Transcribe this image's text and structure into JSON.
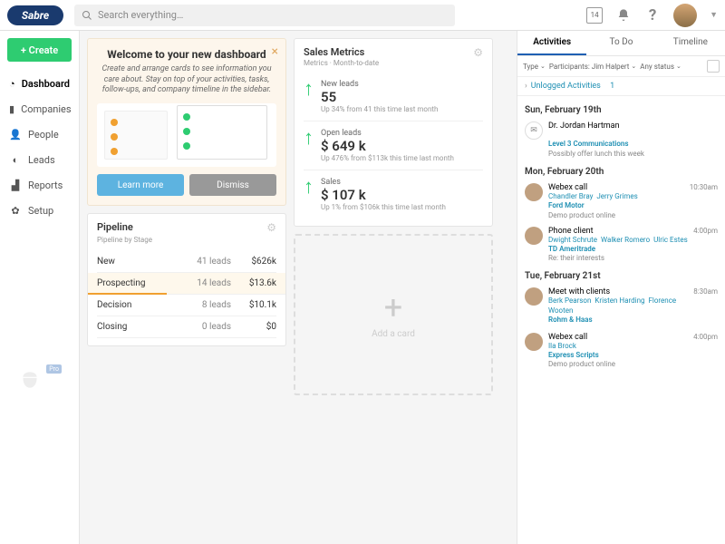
{
  "header": {
    "logo": "Sabre",
    "search_placeholder": "Search everything…",
    "cal_badge": "14"
  },
  "sidebar": {
    "create": "+ Create",
    "items": [
      {
        "label": "Dashboard",
        "active": true
      },
      {
        "label": "Companies"
      },
      {
        "label": "People"
      },
      {
        "label": "Leads"
      },
      {
        "label": "Reports"
      },
      {
        "label": "Setup"
      }
    ],
    "pro": "Pro"
  },
  "welcome": {
    "title": "Welcome to your new dashboard",
    "body": "Create and arrange cards to see information you care about. Stay on top of your activities, tasks, follow-ups, and company timeline in the sidebar.",
    "learn": "Learn more",
    "dismiss": "Dismiss"
  },
  "pipeline": {
    "title": "Pipeline",
    "sub": "Pipeline by Stage",
    "rows": [
      {
        "name": "New",
        "leads": "41 leads",
        "val": "$626k"
      },
      {
        "name": "Prospecting",
        "leads": "14 leads",
        "val": "$13.6k",
        "hl": true
      },
      {
        "name": "Decision",
        "leads": "8 leads",
        "val": "$10.1k"
      },
      {
        "name": "Closing",
        "leads": "0 leads",
        "val": "$0"
      }
    ]
  },
  "metrics": {
    "title": "Sales Metrics",
    "sub": "Metrics · Month-to-date",
    "rows": [
      {
        "label": "New leads",
        "val": "55",
        "chg": "Up 34% from 41 this time last month"
      },
      {
        "label": "Open leads",
        "val": "$ 649 k",
        "chg": "Up 476% from $113k this time last month"
      },
      {
        "label": "Sales",
        "val": "$ 107 k",
        "chg": "Up 1% from $106k this time last month"
      }
    ]
  },
  "addcard": "Add a card",
  "right": {
    "tabs": [
      "Activities",
      "To Do",
      "Timeline"
    ],
    "filters": {
      "type": "Type",
      "participants": "Participants: Jim Halpert",
      "status": "Any status"
    },
    "unlogged": {
      "label": "Unlogged Activities",
      "count": "1"
    },
    "days": [
      {
        "date": "Sun, February 19th",
        "acts": [
          {
            "icon": true,
            "title": "Dr. Jordan Hartman",
            "people": [],
            "co": "Level 3 Communications",
            "note": "Possibly offer lunch this week",
            "time": ""
          }
        ]
      },
      {
        "date": "Mon, February 20th",
        "acts": [
          {
            "title": "Webex call",
            "people": [
              "Chandler Bray",
              "Jerry Grimes"
            ],
            "co": "Ford Motor",
            "note": "Demo product online",
            "time": "10:30am"
          },
          {
            "title": "Phone client",
            "people": [
              "Dwight Schrute",
              "Walker Romero",
              "Ulric Estes"
            ],
            "co": "TD Ameritrade",
            "note": "Re: their interests",
            "time": "4:00pm"
          }
        ]
      },
      {
        "date": "Tue, February 21st",
        "acts": [
          {
            "title": "Meet with clients",
            "people": [
              "Berk Pearson",
              "Kristen Harding",
              "Florence Wooten"
            ],
            "co": "Rohm & Haas",
            "note": "",
            "time": "8:30am"
          },
          {
            "title": "Webex call",
            "people": [
              "Ila Brock"
            ],
            "co": "Express Scripts",
            "note": "Demo product online",
            "time": "4:00pm"
          }
        ]
      }
    ]
  }
}
